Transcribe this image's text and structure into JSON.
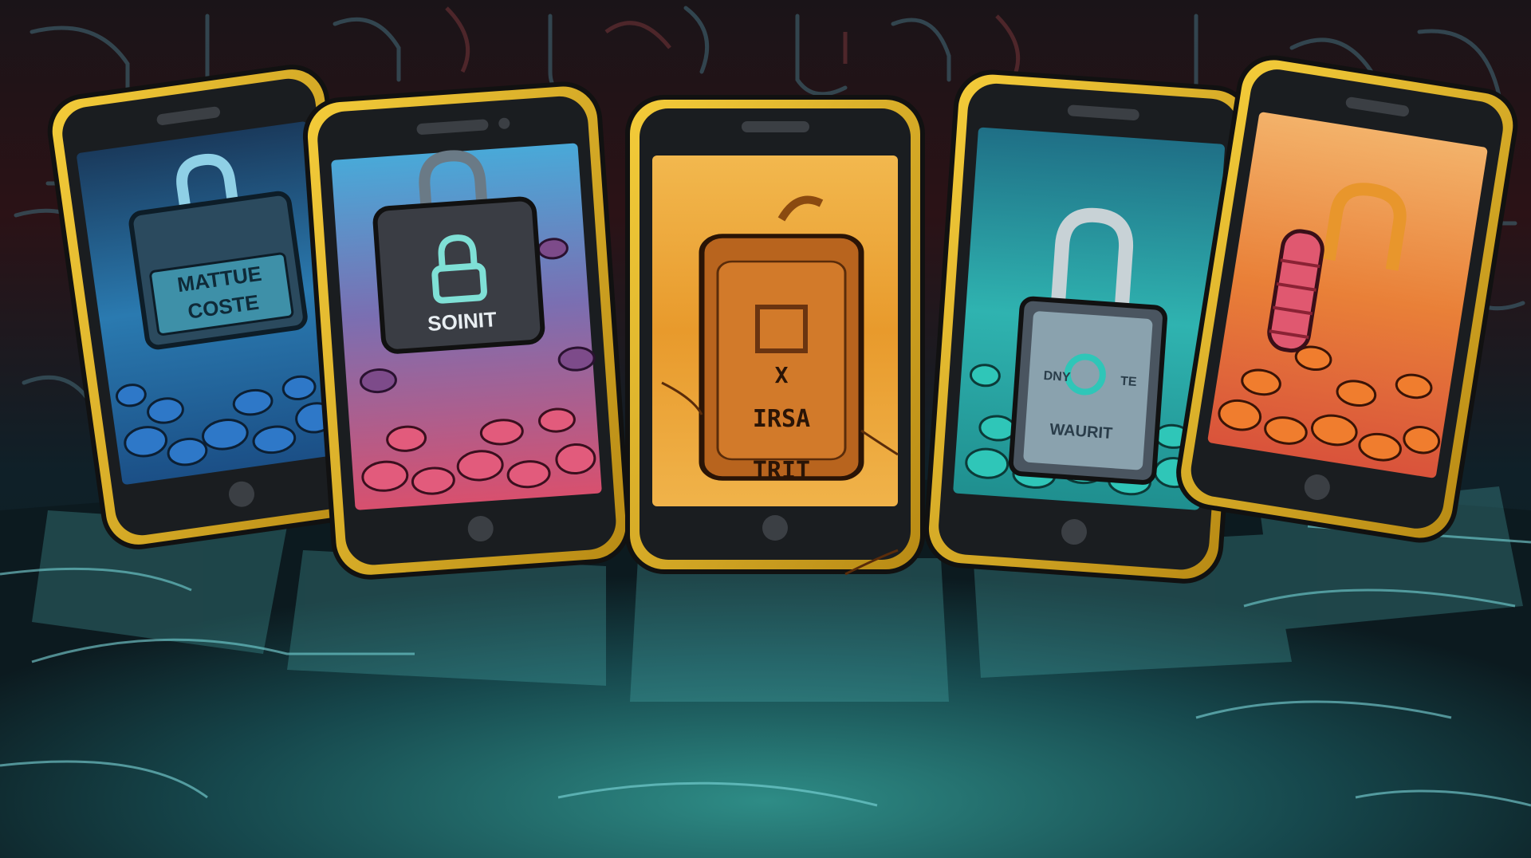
{
  "colors": {
    "background_top": "#2b1216",
    "background_mid": "#0f2028",
    "floor": "#1f6a6a",
    "circuit_line": "#3a5661",
    "phone_frame": "#e0b224",
    "bezel": "#1a1d20"
  },
  "phones": [
    {
      "screen_theme": "blue",
      "icon": "padlock-icon",
      "text_lines": [
        "MATTUE",
        "COSTE"
      ]
    },
    {
      "screen_theme": "blue-to-pink",
      "icon": "padlock-icon",
      "text_lines": [
        "SOINIT"
      ]
    },
    {
      "screen_theme": "orange",
      "icon": "tag-icon",
      "text_lines": [
        "X",
        "IRSA",
        "TRIT"
      ]
    },
    {
      "screen_theme": "teal",
      "icon": "padlock-icon",
      "text_lines": [
        "DNY",
        "TE",
        "WAURIT"
      ]
    },
    {
      "screen_theme": "orange-red",
      "icon": "padlock-icon",
      "text_lines": []
    }
  ]
}
